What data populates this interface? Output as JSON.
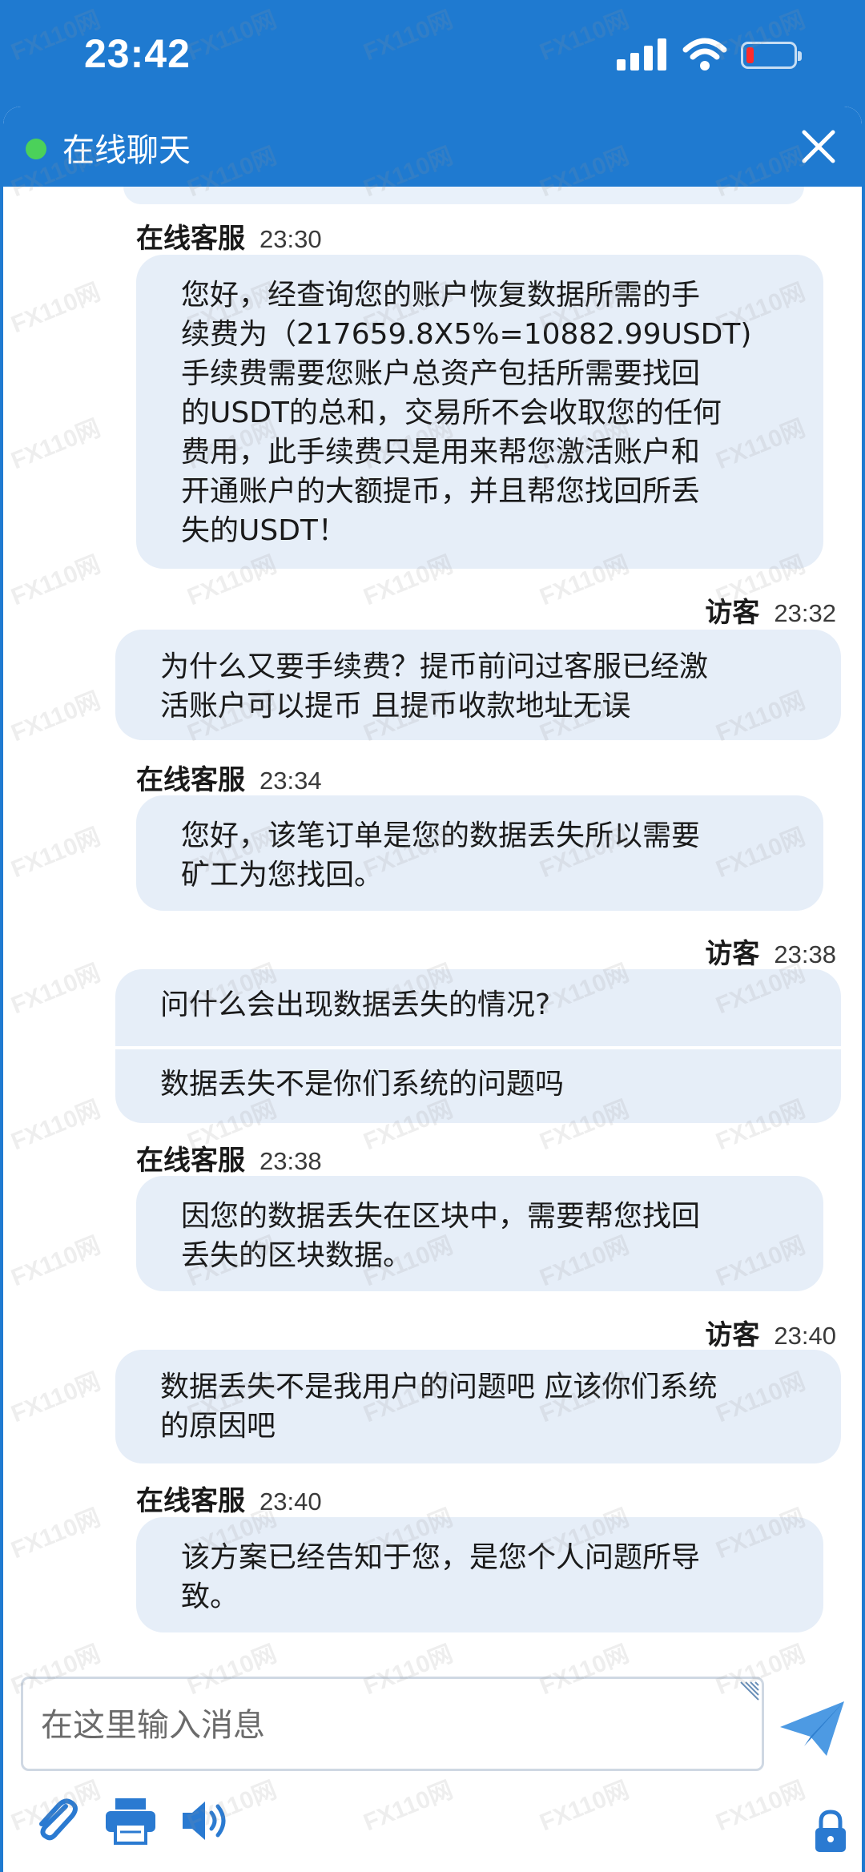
{
  "status_bar": {
    "time": "23:42",
    "icons": [
      "cellular-signal-icon",
      "wifi-icon",
      "battery-low-icon"
    ]
  },
  "chat": {
    "title": "在线聊天",
    "status_color": "#4bd15a",
    "header_color": "#1f7ad0",
    "messages": [
      {
        "sender": "在线客服",
        "time": "23:30",
        "role": "agent",
        "lines": "您好，经查询您的账户恢复数据所需的手\n续费为（217659.8X5%=10882.99USDT)\n手续费需要您账户总资产包括所需要找回\n的USDT的总和，交易所不会收取您的任何\n费用，此手续费只是用来帮您激活账户和\n开通账户的大额提币，并且帮您找回所丢\n失的USDT！"
      },
      {
        "sender": "访客",
        "time": "23:32",
        "role": "visitor",
        "lines": "为什么又要手续费？提币前问过客服已经激\n活账户可以提币 且提币收款地址无误"
      },
      {
        "sender": "在线客服",
        "time": "23:34",
        "role": "agent",
        "lines": "您好，该笔订单是您的数据丢失所以需要\n矿工为您找回。"
      },
      {
        "sender": "访客",
        "time": "23:38",
        "role": "visitor",
        "lines": "问什么会出现数据丢失的情况?",
        "lines2": "数据丢失不是你们系统的问题吗"
      },
      {
        "sender": "在线客服",
        "time": "23:38",
        "role": "agent",
        "lines": "因您的数据丢失在区块中，需要帮您找回\n丢失的区块数据。"
      },
      {
        "sender": "访客",
        "time": "23:40",
        "role": "visitor",
        "lines": "数据丢失不是我用户的问题吧 应该你们系统\n的原因吧"
      },
      {
        "sender": "在线客服",
        "time": "23:40",
        "role": "agent",
        "lines": "该方案已经告知于您，是您个人问题所导\n致。"
      }
    ]
  },
  "composer": {
    "placeholder": "在这里输入消息",
    "tools": [
      "paperclip-icon",
      "printer-icon",
      "speaker-icon"
    ],
    "send_icon": "send-icon",
    "lock_icon": "lock-icon"
  },
  "watermark": "FX110网"
}
